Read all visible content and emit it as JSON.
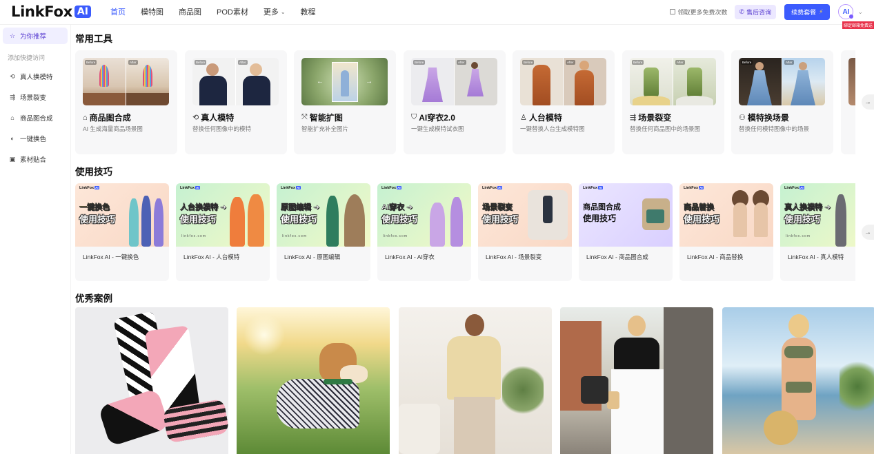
{
  "header": {
    "logo_text": "LinkFox",
    "logo_badge": "AI",
    "nav": [
      {
        "label": "首页",
        "active": true
      },
      {
        "label": "模特图",
        "active": false
      },
      {
        "label": "商品图",
        "active": false
      },
      {
        "label": "POD素材",
        "active": false
      },
      {
        "label": "更多",
        "active": false,
        "dropdown": true
      },
      {
        "label": "教程",
        "active": false
      }
    ],
    "free_link": "领取更多免费次数",
    "after_sale": "售后咨询",
    "renew": "续费套餐",
    "avatar": "AI",
    "red_tag": "绑定邮箱免费送"
  },
  "sidebar": {
    "recommend": "为你推荐",
    "quick_label": "添加快捷访问",
    "items": [
      {
        "label": "真人换模特",
        "icon": "swap-person-icon"
      },
      {
        "label": "场景裂变",
        "icon": "scene-split-icon"
      },
      {
        "label": "商品图合成",
        "icon": "bag-icon"
      },
      {
        "label": "一键换色",
        "icon": "color-icon"
      },
      {
        "label": "素材贴合",
        "icon": "paste-icon"
      }
    ]
  },
  "sections": {
    "tools": "常用工具",
    "tips": "使用技巧",
    "cases": "优秀案例"
  },
  "tools": [
    {
      "title": "商品图合成",
      "desc": "AI 生成海量商品场景图",
      "icon": "bag-icon",
      "tag1": "Before",
      "tag2": "After"
    },
    {
      "title": "真人模特",
      "desc": "替换任何图像中的模特",
      "icon": "swap-person-icon",
      "tag1": "Before",
      "tag2": "After"
    },
    {
      "title": "智能扩图",
      "desc": "智能扩充补全图片",
      "icon": "expand-icon",
      "tag1": "",
      "tag2": ""
    },
    {
      "title": "AI穿衣2.0",
      "desc": "一键生成模特试衣图",
      "icon": "shirt-icon",
      "tag1": "Before",
      "tag2": "After"
    },
    {
      "title": "人台模特",
      "desc": "一键替换人台生成模特图",
      "icon": "mannequin-icon",
      "tag1": "Before",
      "tag2": "After"
    },
    {
      "title": "场景裂变",
      "desc": "替换任何商品图中的场景图",
      "icon": "scene-split-icon",
      "tag1": "Before",
      "tag2": "After"
    },
    {
      "title": "模特换场景",
      "desc": "替换任何模特图像中的场景",
      "icon": "scene-swap-icon",
      "tag1": "Before",
      "tag2": "After"
    }
  ],
  "tips": [
    {
      "caption": "LinkFox AI - 一键换色",
      "line1": "一键换色",
      "line2": "使用技巧"
    },
    {
      "caption": "LinkFox AI - 人台模特",
      "line1": "人台换模特 ➜",
      "line2": "使用技巧"
    },
    {
      "caption": "LinkFox AI - 原图编辑",
      "line1": "原图编辑 ➜",
      "line2": "使用技巧"
    },
    {
      "caption": "LinkFox AI - AI穿衣",
      "line1": "AI穿衣 ➜",
      "line2": "使用技巧"
    },
    {
      "caption": "LinkFox AI - 场景裂变",
      "line1": "场景裂变",
      "line2": "使用技巧"
    },
    {
      "caption": "LinkFox AI - 商品图合成",
      "line1": "商品图合成",
      "line2": "使用技巧"
    },
    {
      "caption": "LinkFox AI - 商品替换",
      "line1": "商品替换",
      "line2": "使用技巧"
    },
    {
      "caption": "LinkFox AI - 真人模特",
      "line1": "真人换模特 ➜",
      "line2": "使用技巧"
    }
  ],
  "tip_brand": "LinkFox",
  "tip_brand_badge": "AI",
  "tip_site": "linkfox.com",
  "colors": {
    "accent": "#3b5bfd",
    "purple": "#5a3fd1",
    "card_bg": "#f7f7f8"
  }
}
